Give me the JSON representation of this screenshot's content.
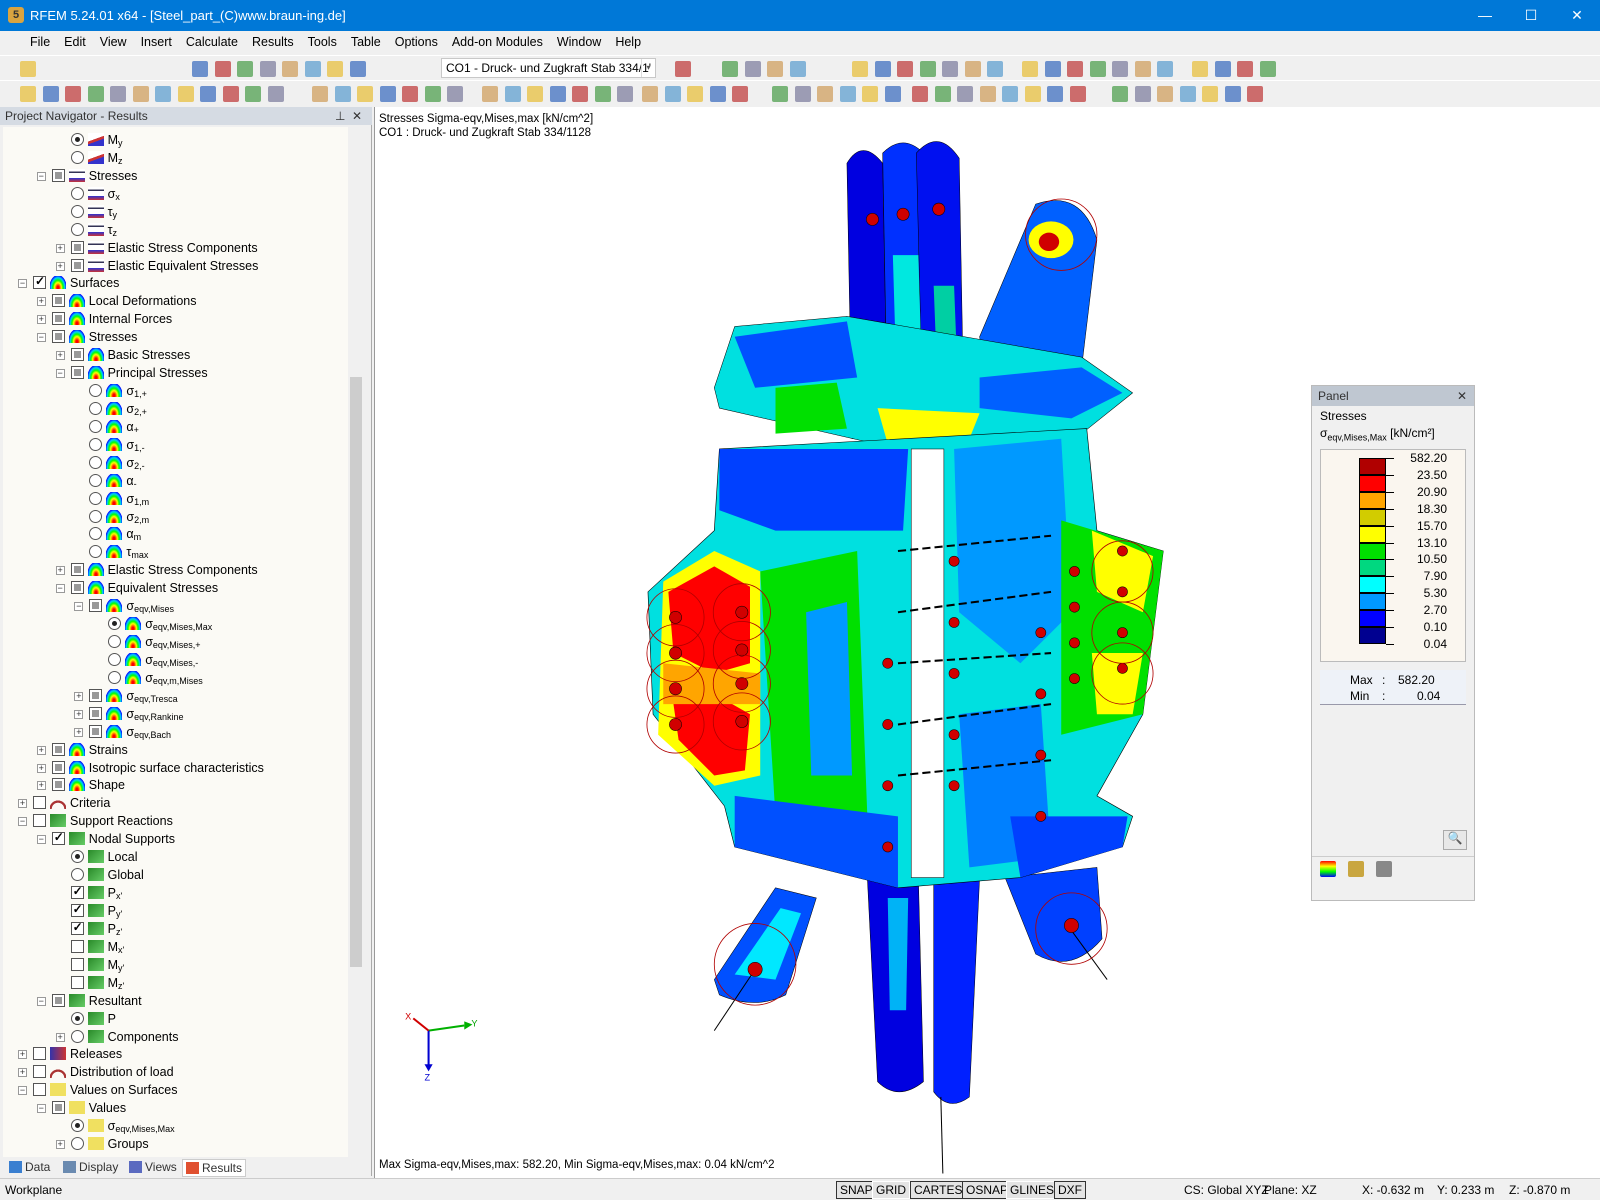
{
  "window": {
    "title": "RFEM 5.24.01 x64 - [Steel_part_(C)www.braun-ing.de]",
    "logo": "5",
    "minimize": "—",
    "maximize": "☐",
    "close": "✕"
  },
  "menu": [
    "File",
    "Edit",
    "View",
    "Insert",
    "Calculate",
    "Results",
    "Tools",
    "Table",
    "Options",
    "Add-on Modules",
    "Window",
    "Help"
  ],
  "toolbar": {
    "load_combo": "CO1 - Druck- und Zugkraft Stab 334/1'",
    "combo_arrow": "▾"
  },
  "navigator": {
    "title": "Project Navigator - Results",
    "pin": "⊥",
    "close": "✕",
    "items": [
      {
        "lv": 2,
        "ctl": "radio",
        "on": true,
        "icon": "member",
        "label": "M",
        "sub": "y"
      },
      {
        "lv": 2,
        "ctl": "radio",
        "on": false,
        "icon": "member",
        "label": "M",
        "sub": "z"
      },
      {
        "lv": 1,
        "ctl": "square",
        "exp": "-",
        "icon": "stress",
        "label": "Stresses"
      },
      {
        "lv": 2,
        "ctl": "radio",
        "on": false,
        "icon": "stress",
        "label": "σ",
        "sub": "x"
      },
      {
        "lv": 2,
        "ctl": "radio",
        "on": false,
        "icon": "stress",
        "label": "τ",
        "sub": "y"
      },
      {
        "lv": 2,
        "ctl": "radio",
        "on": false,
        "icon": "stress",
        "label": "τ",
        "sub": "z"
      },
      {
        "lv": 2,
        "ctl": "square",
        "exp": "+",
        "icon": "stress",
        "label": "Elastic Stress Components"
      },
      {
        "lv": 2,
        "ctl": "square",
        "exp": "+",
        "icon": "stress",
        "label": "Elastic Equivalent Stresses"
      },
      {
        "lv": 0,
        "ctl": "check",
        "on": true,
        "exp": "-",
        "icon": "surface",
        "label": "Surfaces"
      },
      {
        "lv": 1,
        "ctl": "square",
        "exp": "+",
        "icon": "surface",
        "label": "Local Deformations"
      },
      {
        "lv": 1,
        "ctl": "square",
        "exp": "+",
        "icon": "surface",
        "label": "Internal Forces"
      },
      {
        "lv": 1,
        "ctl": "square",
        "exp": "-",
        "icon": "surface",
        "label": "Stresses"
      },
      {
        "lv": 2,
        "ctl": "square",
        "exp": "+",
        "icon": "surface",
        "label": "Basic Stresses"
      },
      {
        "lv": 2,
        "ctl": "square",
        "exp": "-",
        "icon": "surface",
        "label": "Principal Stresses"
      },
      {
        "lv": 3,
        "ctl": "radio",
        "on": false,
        "icon": "surface",
        "label": "σ",
        "sub": "1,+"
      },
      {
        "lv": 3,
        "ctl": "radio",
        "on": false,
        "icon": "surface",
        "label": "σ",
        "sub": "2,+"
      },
      {
        "lv": 3,
        "ctl": "radio",
        "on": false,
        "icon": "surface",
        "label": "α",
        "sub": "+"
      },
      {
        "lv": 3,
        "ctl": "radio",
        "on": false,
        "icon": "surface",
        "label": "σ",
        "sub": "1,-"
      },
      {
        "lv": 3,
        "ctl": "radio",
        "on": false,
        "icon": "surface",
        "label": "σ",
        "sub": "2,-"
      },
      {
        "lv": 3,
        "ctl": "radio",
        "on": false,
        "icon": "surface",
        "label": "α",
        "sub": "-"
      },
      {
        "lv": 3,
        "ctl": "radio",
        "on": false,
        "icon": "surface",
        "label": "σ",
        "sub": "1,m"
      },
      {
        "lv": 3,
        "ctl": "radio",
        "on": false,
        "icon": "surface",
        "label": "σ",
        "sub": "2,m"
      },
      {
        "lv": 3,
        "ctl": "radio",
        "on": false,
        "icon": "surface",
        "label": "α",
        "sub": "m"
      },
      {
        "lv": 3,
        "ctl": "radio",
        "on": false,
        "icon": "surface",
        "label": "τ",
        "sub": "max"
      },
      {
        "lv": 2,
        "ctl": "square",
        "exp": "+",
        "icon": "surface",
        "label": "Elastic Stress Components"
      },
      {
        "lv": 2,
        "ctl": "square",
        "exp": "-",
        "icon": "surface",
        "label": "Equivalent Stresses"
      },
      {
        "lv": 3,
        "ctl": "square",
        "exp": "-",
        "icon": "surface",
        "label": "σ",
        "sub": "eqv,Mises"
      },
      {
        "lv": 4,
        "ctl": "radio",
        "on": true,
        "icon": "surface",
        "label": "σ",
        "sub": "eqv,Mises,Max"
      },
      {
        "lv": 4,
        "ctl": "radio",
        "on": false,
        "icon": "surface",
        "label": "σ",
        "sub": "eqv,Mises,+"
      },
      {
        "lv": 4,
        "ctl": "radio",
        "on": false,
        "icon": "surface",
        "label": "σ",
        "sub": "eqv,Mises,-"
      },
      {
        "lv": 4,
        "ctl": "radio",
        "on": false,
        "icon": "surface",
        "label": "σ",
        "sub": "eqv,m,Mises"
      },
      {
        "lv": 3,
        "ctl": "square",
        "exp": "+",
        "icon": "surface",
        "label": "σ",
        "sub": "eqv,Tresca"
      },
      {
        "lv": 3,
        "ctl": "square",
        "exp": "+",
        "icon": "surface",
        "label": "σ",
        "sub": "eqv,Rankine"
      },
      {
        "lv": 3,
        "ctl": "square",
        "exp": "+",
        "icon": "surface",
        "label": "σ",
        "sub": "eqv,Bach"
      },
      {
        "lv": 1,
        "ctl": "square",
        "exp": "+",
        "icon": "surface",
        "label": "Strains"
      },
      {
        "lv": 1,
        "ctl": "square",
        "exp": "+",
        "icon": "surface",
        "label": "Isotropic surface characteristics"
      },
      {
        "lv": 1,
        "ctl": "square",
        "exp": "+",
        "icon": "surface",
        "label": "Shape"
      },
      {
        "lv": 0,
        "ctl": "check",
        "on": false,
        "exp": "+",
        "icon": "criteria",
        "label": "Criteria"
      },
      {
        "lv": 0,
        "ctl": "check",
        "on": false,
        "exp": "-",
        "icon": "support",
        "label": "Support Reactions"
      },
      {
        "lv": 1,
        "ctl": "check",
        "on": true,
        "exp": "-",
        "icon": "support",
        "label": "Nodal Supports"
      },
      {
        "lv": 2,
        "ctl": "radio",
        "on": true,
        "icon": "support",
        "label": "Local"
      },
      {
        "lv": 2,
        "ctl": "radio",
        "on": false,
        "icon": "support",
        "label": "Global"
      },
      {
        "lv": 2,
        "ctl": "check",
        "on": true,
        "icon": "support",
        "label": "P",
        "sub": "x'"
      },
      {
        "lv": 2,
        "ctl": "check",
        "on": true,
        "icon": "support",
        "label": "P",
        "sub": "y'"
      },
      {
        "lv": 2,
        "ctl": "check",
        "on": true,
        "icon": "support",
        "label": "P",
        "sub": "z'"
      },
      {
        "lv": 2,
        "ctl": "check",
        "on": false,
        "icon": "support",
        "label": "M",
        "sub": "x'"
      },
      {
        "lv": 2,
        "ctl": "check",
        "on": false,
        "icon": "support",
        "label": "M",
        "sub": "y'"
      },
      {
        "lv": 2,
        "ctl": "check",
        "on": false,
        "icon": "support",
        "label": "M",
        "sub": "z'"
      },
      {
        "lv": 1,
        "ctl": "square",
        "exp": "-",
        "icon": "support",
        "label": "Resultant"
      },
      {
        "lv": 2,
        "ctl": "radio",
        "on": true,
        "icon": "support",
        "label": "P"
      },
      {
        "lv": 2,
        "ctl": "radio",
        "on": false,
        "exp": "+",
        "icon": "support",
        "label": "Components"
      },
      {
        "lv": 0,
        "ctl": "check",
        "on": false,
        "exp": "+",
        "icon": "release",
        "label": "Releases"
      },
      {
        "lv": 0,
        "ctl": "check",
        "on": false,
        "exp": "+",
        "icon": "criteria",
        "label": "Distribution of load"
      },
      {
        "lv": 0,
        "ctl": "check",
        "on": false,
        "exp": "-",
        "icon": "values",
        "label": "Values on Surfaces"
      },
      {
        "lv": 1,
        "ctl": "square",
        "exp": "-",
        "icon": "values",
        "label": "Values"
      },
      {
        "lv": 2,
        "ctl": "radio",
        "on": true,
        "icon": "values",
        "label": "σ",
        "sub": "eqv,Mises,Max"
      },
      {
        "lv": 2,
        "ctl": "radio",
        "on": false,
        "exp": "+",
        "icon": "values",
        "label": "Groups"
      }
    ],
    "tabs": [
      {
        "label": "Data",
        "active": false
      },
      {
        "label": "Display",
        "active": false
      },
      {
        "label": "Views",
        "active": false
      },
      {
        "label": "Results",
        "active": true
      }
    ]
  },
  "viewport": {
    "line1": "Stresses Sigma-eqv,Mises,max [kN/cm^2]",
    "line2": "CO1 : Druck- und Zugkraft Stab 334/1128",
    "bottom": "Max Sigma-eqv,Mises,max: 582.20, Min Sigma-eqv,Mises,max: 0.04 kN/cm^2",
    "axes": {
      "x": "X",
      "y": "Y",
      "z": "Z"
    }
  },
  "panel": {
    "title": "Panel",
    "close": "✕",
    "heading": "Stresses",
    "quantity": "σ",
    "quantity_sub": "eqv,Mises,Max",
    "unit": "[kN/cm²]",
    "legend": {
      "values": [
        "582.20",
        "23.50",
        "20.90",
        "18.30",
        "15.70",
        "13.10",
        "10.50",
        "7.90",
        "5.30",
        "2.70",
        "0.10",
        "0.04"
      ],
      "colors": [
        "#b00000",
        "#ff0000",
        "#ffa500",
        "#d2cc00",
        "#ffff00",
        "#00e000",
        "#00d880",
        "#00ffff",
        "#0099ff",
        "#0000ff",
        "#000090"
      ]
    },
    "max_label": "Max",
    "max_value": "582.20",
    "min_label": "Min",
    "min_value": "0.04",
    "sep": ":"
  },
  "status": {
    "toggles": [
      "SNAP",
      "GRID",
      "CARTES",
      "OSNAP",
      "GLINES",
      "DXF"
    ],
    "workplane": "Workplane",
    "cs": "CS: Global XYZ",
    "plane": "Plane: XZ",
    "x": "X:  -0.632 m",
    "y": "Y:  0.233 m",
    "z": "Z:  -0.870 m"
  }
}
